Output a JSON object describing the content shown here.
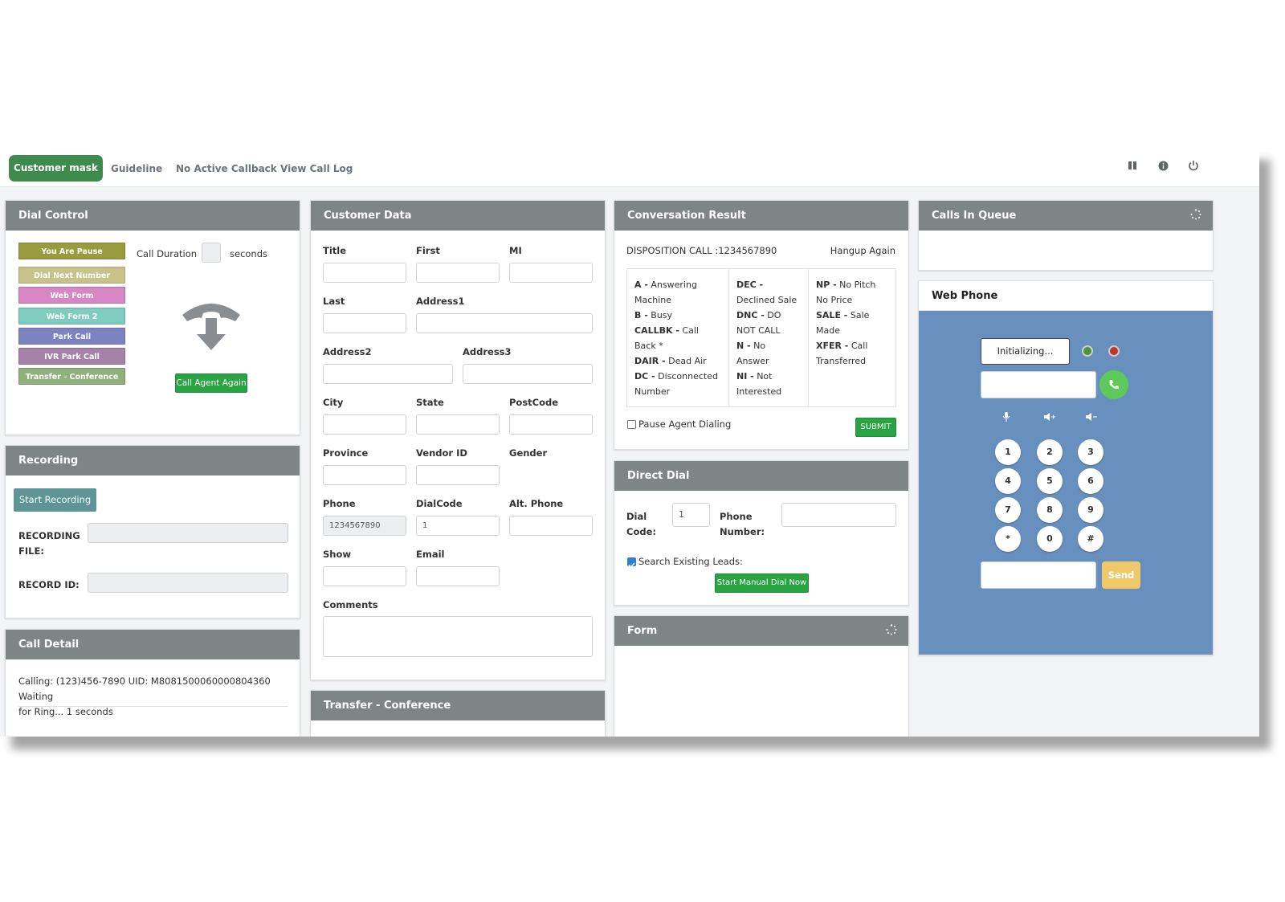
{
  "nav": {
    "active_tab": "Customer mask",
    "links": [
      "Guideline",
      "No Active Callback",
      "View Call Log"
    ],
    "icons": [
      "pause-icon",
      "info-icon",
      "power-icon"
    ]
  },
  "dial_control": {
    "title": "Dial Control",
    "buttons": [
      {
        "label": "You Are Pause",
        "color": "#9a9a3e"
      },
      {
        "label": "Dial Next Number",
        "color": "#c9c28b"
      },
      {
        "label": "Web Form",
        "color": "#d687c4"
      },
      {
        "label": "Web Form 2",
        "color": "#7ecdc0"
      },
      {
        "label": "Park Call",
        "color": "#7d83c1"
      },
      {
        "label": "IVR Park Call",
        "color": "#a682a8"
      },
      {
        "label": "Transfer - Conference",
        "color": "#8fb07a"
      }
    ],
    "call_duration_label": "Call Duration",
    "seconds_label": "seconds",
    "call_agent_again": "Call Agent Again"
  },
  "recording": {
    "title": "Recording",
    "start_button": "Start Recording",
    "file_label": "RECORDING FILE:",
    "id_label": "RECORD ID:"
  },
  "call_detail": {
    "title": "Call Detail",
    "line1": "Calling: (123)456-7890 UID: M8081500060000804360   Waiting",
    "line2": "for Ring... 1 seconds"
  },
  "customer_data": {
    "title": "Customer Data",
    "labels": {
      "title": "Title",
      "first": "First",
      "mi": "MI",
      "last": "Last",
      "address1": "Address1",
      "address2": "Address2",
      "address3": "Address3",
      "city": "City",
      "state": "State",
      "postcode": "PostCode",
      "province": "Province",
      "vendor_id": "Vendor ID",
      "gender": "Gender",
      "phone": "Phone",
      "dialcode": "DialCode",
      "alt_phone": "Alt. Phone",
      "show": "Show",
      "email": "Email",
      "comments": "Comments"
    },
    "values": {
      "phone": "1234567890",
      "dialcode": "1"
    }
  },
  "transfer_conference": {
    "title": "Transfer - Conference"
  },
  "conversation_result": {
    "title": "Conversation Result",
    "disposition": "DISPOSITION CALL :1234567890",
    "hangup": "Hangup Again",
    "codes": [
      [
        {
          "code": "A -",
          "desc": " Answering Machine"
        },
        {
          "code": "B -",
          "desc": " Busy"
        },
        {
          "code": "CALLBK -",
          "desc": " Call Back *"
        },
        {
          "code": "DAIR -",
          "desc": " Dead Air"
        },
        {
          "code": "DC -",
          "desc": " Disconnected Number"
        }
      ],
      [
        {
          "code": "DEC -",
          "desc": " Declined Sale"
        },
        {
          "code": "DNC -",
          "desc": " DO NOT CALL"
        },
        {
          "code": "N -",
          "desc": " No Answer"
        },
        {
          "code": "NI -",
          "desc": " Not Interested"
        }
      ],
      [
        {
          "code": "NP -",
          "desc": " No Pitch No Price"
        },
        {
          "code": "SALE -",
          "desc": " Sale Made"
        },
        {
          "code": "XFER -",
          "desc": " Call Transferred"
        }
      ]
    ],
    "pause_agent_label": "Pause Agent Dialing",
    "submit": "SUBMIT"
  },
  "direct_dial": {
    "title": "Direct Dial",
    "dial_code_label_1": "Dial",
    "dial_code_label_2": "Code:",
    "dial_code_value": "1",
    "phone_number_label_1": "Phone",
    "phone_number_label_2": "Number:",
    "search_existing_label": "Search Existing Leads:",
    "start_button": "Start Manual Dial Now"
  },
  "form_panel": {
    "title": "Form"
  },
  "calls_in_queue": {
    "title": "Calls In Queue"
  },
  "web_phone": {
    "title": "Web Phone",
    "status": "Initializing...",
    "keys": [
      "1",
      "2",
      "3",
      "4",
      "5",
      "6",
      "7",
      "8",
      "9",
      "*",
      "0",
      "#"
    ],
    "send": "Send",
    "colors": {
      "background": "#6890be",
      "call": "#5cc95a",
      "send": "#f0c96a"
    }
  }
}
